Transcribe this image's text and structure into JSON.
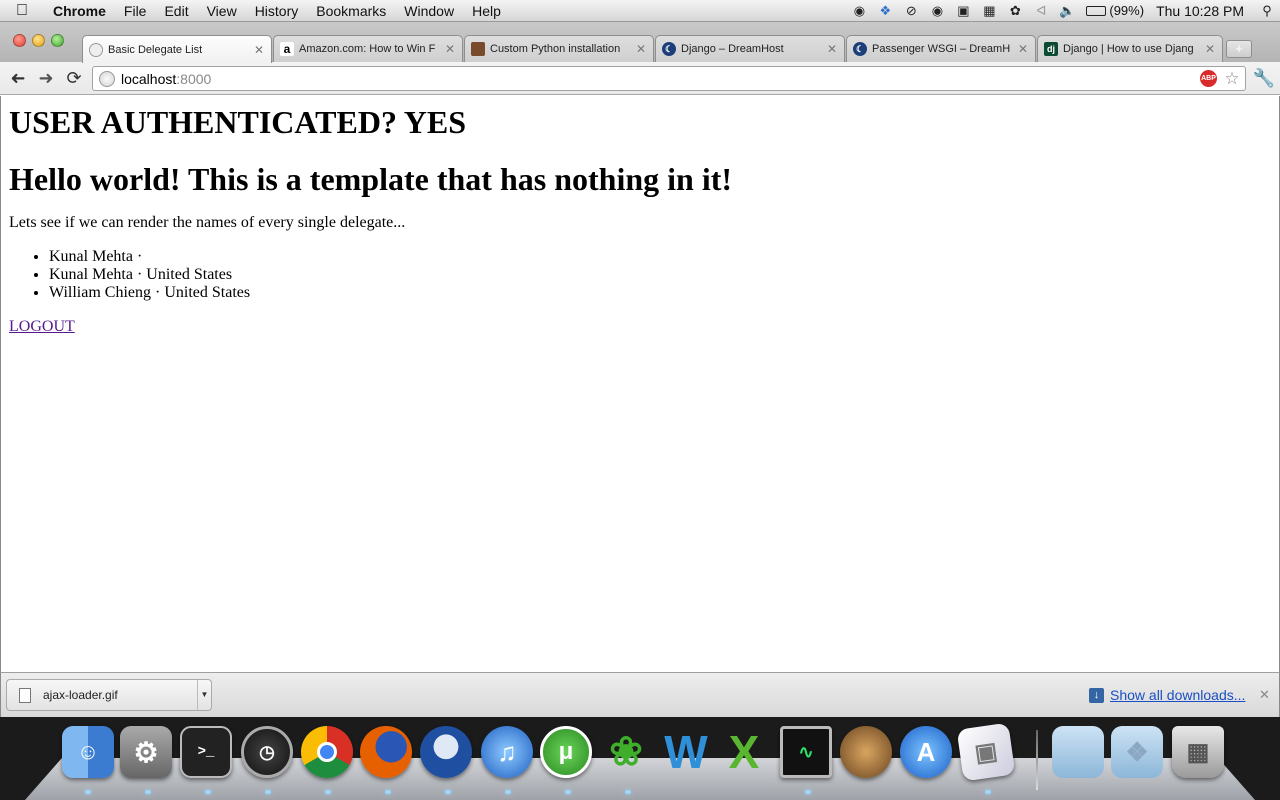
{
  "menubar": {
    "app_name": "Chrome",
    "menus": [
      "File",
      "Edit",
      "View",
      "History",
      "Bookmarks",
      "Window",
      "Help"
    ],
    "battery_percent": "(99%)",
    "clock": "Thu 10:28 PM"
  },
  "tabs": [
    {
      "title": "Basic Delegate List",
      "favicon": "globe-icon",
      "active": true
    },
    {
      "title": "Amazon.com: How to Win F",
      "favicon": "amazon-icon",
      "active": false
    },
    {
      "title": "Custom Python installation",
      "favicon": "photo-icon",
      "active": false
    },
    {
      "title": "Django – DreamHost",
      "favicon": "dreamhost-icon",
      "active": false
    },
    {
      "title": "Passenger WSGI – DreamH",
      "favicon": "dreamhost-icon",
      "active": false
    },
    {
      "title": "Django | How to use Djang",
      "favicon": "django-icon",
      "active": false
    }
  ],
  "toolbar": {
    "url_host": "localhost",
    "url_port": ":8000",
    "adblock_label": "ABP"
  },
  "content": {
    "heading_auth": "USER AUTHENTICATED? YES",
    "heading_hello": "Hello world! This is a template that has nothing in it!",
    "intro": "Lets see if we can render the names of every single delegate...",
    "delegates": [
      "Kunal Mehta ·",
      "Kunal Mehta · United States",
      "William Chieng · United States"
    ],
    "logout_label": "LOGOUT"
  },
  "downloads": {
    "file_name": "ajax-loader.gif",
    "show_all_label": "Show all downloads..."
  },
  "dock": {
    "apps": [
      "finder-icon",
      "system-preferences-icon",
      "terminal-icon",
      "activity-gauge-icon",
      "chrome-icon",
      "firefox-icon",
      "thunderbird-icon",
      "itunes-icon",
      "utorrent-icon",
      "adium-icon",
      "word-icon",
      "excel-icon",
      "activity-monitor-icon",
      "lion-icon",
      "app-store-icon",
      "preview-icon",
      "applications-folder-icon",
      "dropbox-folder-icon",
      "trash-icon"
    ],
    "colors": {
      "chrome": "#d93025",
      "firefox": "#e66000",
      "utorrent": "#3fa637",
      "itunes": "#2d8bd8"
    }
  }
}
